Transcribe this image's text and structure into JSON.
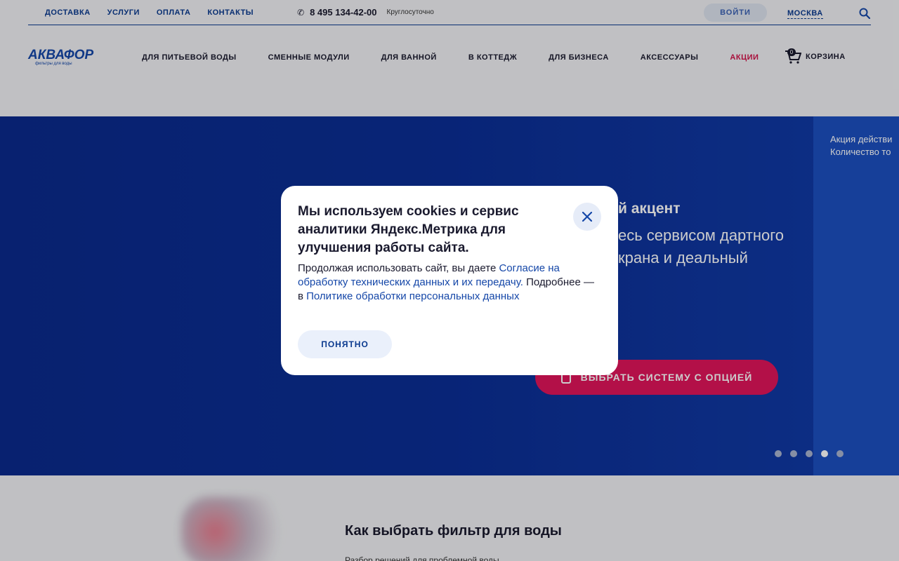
{
  "topbar": {
    "links": [
      "ДОСТАВКА",
      "УСЛУГИ",
      "ОПЛАТА",
      "КОНТАКТЫ"
    ],
    "phone": "8 495 134-42-00",
    "phone_note": "Круглосуточно",
    "login": "ВОЙТИ",
    "city": "МОСКВА"
  },
  "logo": {
    "main": "АКВАФОР",
    "sub": "фильтры для воды"
  },
  "nav": {
    "items": [
      "ДЛЯ ПИТЬЕВОЙ ВОДЫ",
      "СМЕННЫЕ МОДУЛИ",
      "ДЛЯ ВАННОЙ",
      "В КОТТЕДЖ",
      "ДЛЯ БИЗНЕСА",
      "АКСЕССУАРЫ",
      "АКЦИИ"
    ],
    "cart_label": "КОРЗИНА",
    "cart_count": "0"
  },
  "hero": {
    "title": "й акцент",
    "text": "есь сервисом дартного крана и деальный",
    "button": "ВЫБРАТЬ СИСТЕМУ С ОПЦИЕЙ",
    "side_line1": "Акция действи",
    "side_line2": "Количество то"
  },
  "modal": {
    "title": "Мы используем cookies и сервис аналитики Яндекс.Метрика для улучшения работы сайта.",
    "body_text1": "Продолжая использовать сайт, вы даете ",
    "consent_link": "Согласие на обработку технических данных и их передачу.",
    "body_text2": " Подробнее — в ",
    "policy_link": "Политике обработки персональных данных",
    "ok": "ПОНЯТНО"
  },
  "bottom": {
    "title": "Как выбрать фильтр для воды",
    "sub": "Разбор решений для проблемной воды"
  },
  "colors": {
    "brand": "#0b3a8f",
    "accent": "#e0145a",
    "hero_bg": "#0b2e95"
  }
}
